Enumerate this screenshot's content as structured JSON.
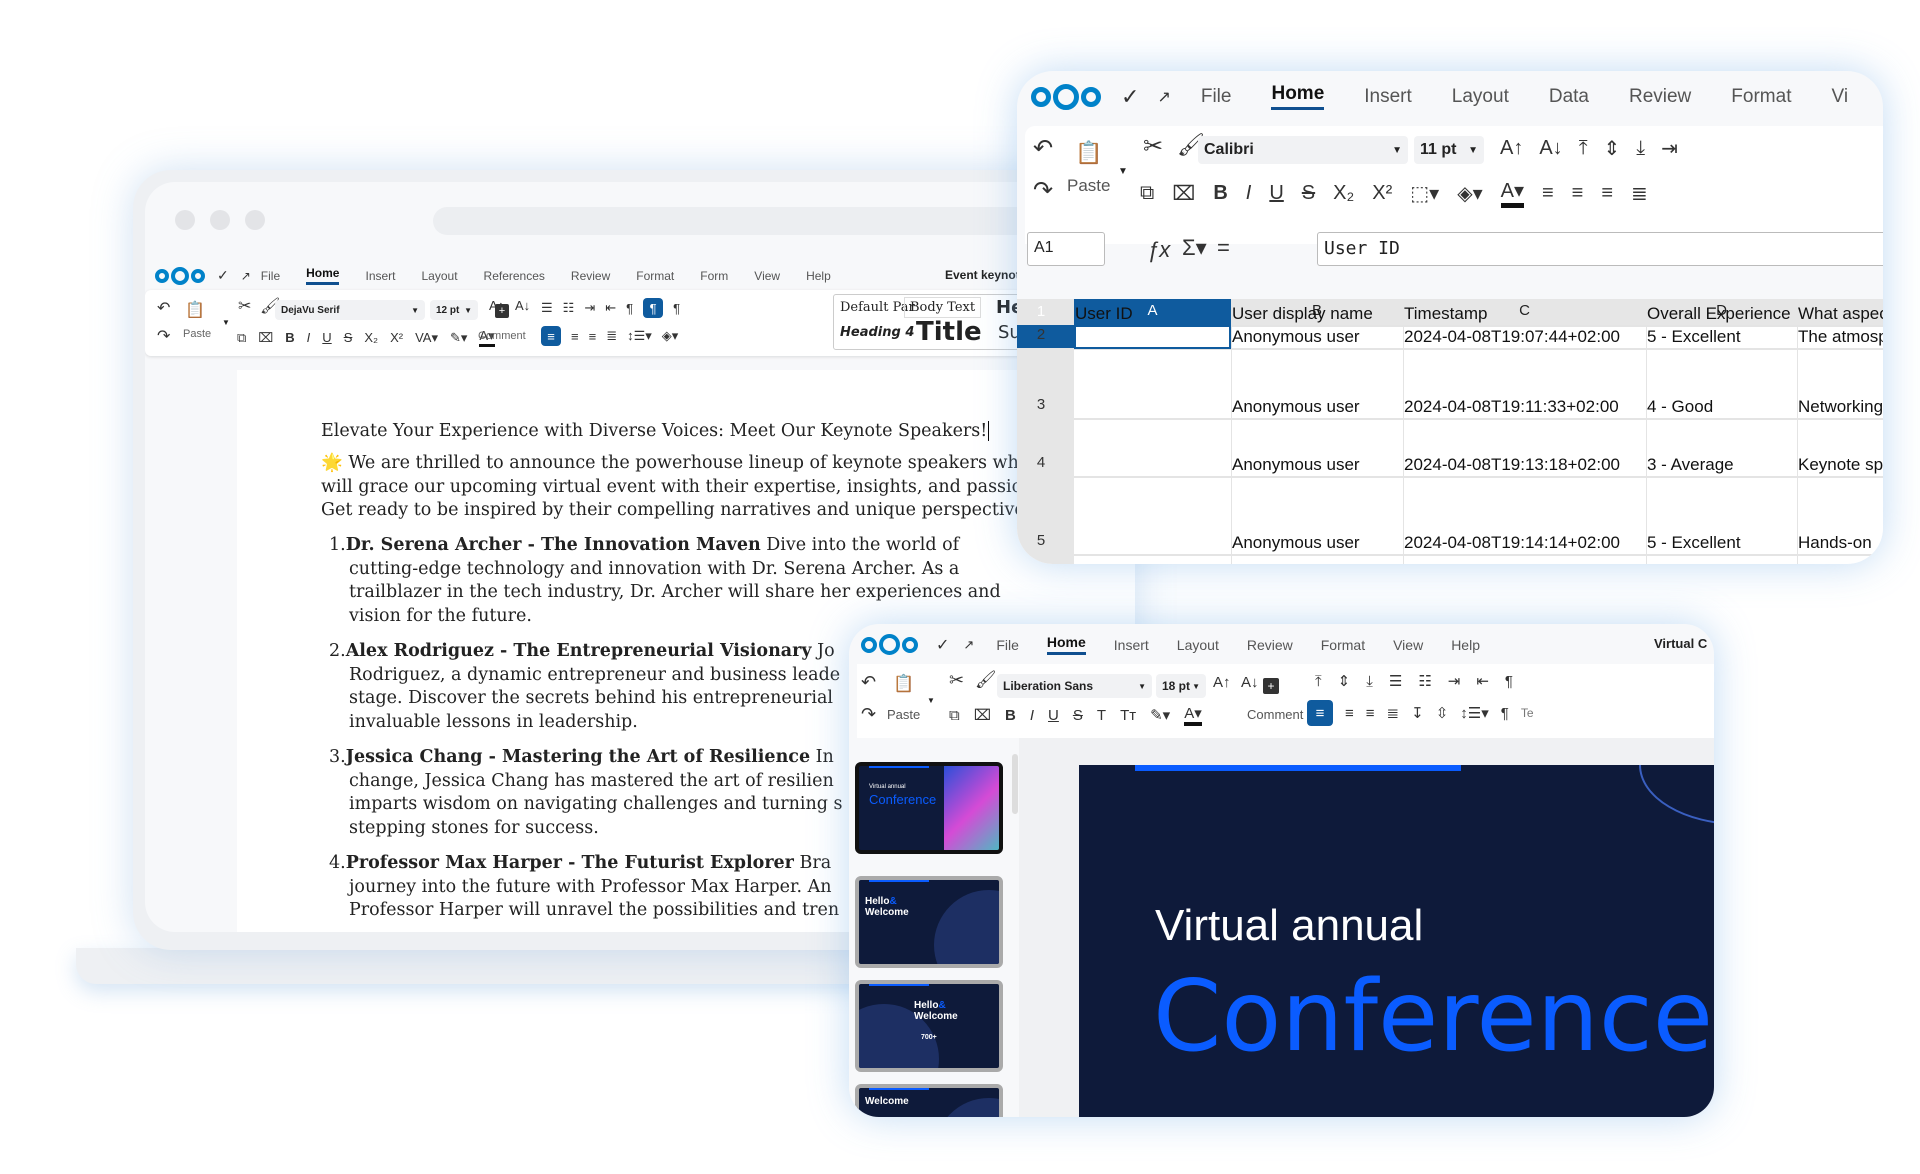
{
  "writer": {
    "doc_title": "Event keynot",
    "tabs": [
      "File",
      "Home",
      "Insert",
      "Layout",
      "References",
      "Review",
      "Format",
      "Form",
      "View",
      "Help"
    ],
    "active_tab": "Home",
    "font": "DejaVu Serif",
    "size": "12 pt",
    "paste_label": "Paste",
    "comment_label": "Comment",
    "styles": [
      "Default Par",
      "Body Text",
      "He",
      "Heading 4",
      "Title",
      "Su"
    ],
    "heading": "Elevate Your Experience with Diverse Voices: Meet Our Keynote Speakers!",
    "intro": [
      "🌟 We are thrilled to announce the powerhouse lineup of keynote speakers who",
      "will grace our upcoming virtual event with their expertise, insights, and passion",
      "Get ready to be inspired by their compelling narratives and unique perspectives"
    ],
    "items": [
      {
        "num": "1.",
        "title": "Dr. Serena Archer - The Innovation Maven",
        "first": " Dive into the world of",
        "lines": [
          "cutting-edge technology and innovation with Dr. Serena Archer. As a",
          "trailblazer in the tech industry, Dr. Archer will share her experiences and",
          "vision for the future."
        ]
      },
      {
        "num": "2.",
        "title": "Alex Rodriguez - The Entrepreneurial Visionary",
        "first": " Jo",
        "lines": [
          "Rodriguez, a dynamic entrepreneur and business leade",
          "stage. Discover the secrets behind his entrepreneurial",
          "invaluable lessons in leadership."
        ]
      },
      {
        "num": "3.",
        "title": "Jessica Chang - Mastering the Art of Resilience",
        "first": " In",
        "lines": [
          "change, Jessica Chang has mastered the art of resilien",
          "imparts wisdom on navigating challenges and turning s",
          "stepping stones for success."
        ]
      },
      {
        "num": "4.",
        "title": "Professor Max Harper - The Futurist Explorer",
        "first": " Bra",
        "lines": [
          "journey into the future with Professor Max Harper. An",
          "Professor Harper will unravel the possibilities and tren"
        ]
      }
    ]
  },
  "calc": {
    "tabs": [
      "File",
      "Home",
      "Insert",
      "Layout",
      "Data",
      "Review",
      "Format",
      "Vi"
    ],
    "active_tab": "Home",
    "font": "Calibri",
    "size": "11 pt",
    "paste_label": "Paste",
    "name_box": "A1",
    "formula": "User ID",
    "columns": [
      "A",
      "B",
      "C",
      "D"
    ],
    "rows": [
      "1",
      "2",
      "3",
      "4",
      "5"
    ],
    "cells": [
      [
        "User ID",
        "User display name",
        "Timestamp",
        "Overall Experience",
        "What aspec"
      ],
      [
        "",
        "Anonymous user",
        "2024-04-08T19:07:44+02:00",
        "5 - Excellent",
        "The atmosp"
      ],
      [
        "",
        "Anonymous user",
        "2024-04-08T19:11:33+02:00",
        "4 - Good",
        "Networking"
      ],
      [
        "",
        "Anonymous user",
        "2024-04-08T19:13:18+02:00",
        "3 - Average",
        "Keynote sp"
      ],
      [
        "",
        "Anonymous user",
        "2024-04-08T19:14:14+02:00",
        "5 - Excellent",
        "Hands-on"
      ]
    ]
  },
  "impress": {
    "doc_title": "Virtual C",
    "tabs": [
      "File",
      "Home",
      "Insert",
      "Layout",
      "Review",
      "Format",
      "View",
      "Help"
    ],
    "active_tab": "Home",
    "font": "Liberation Sans",
    "size": "18 pt",
    "paste_label": "Paste",
    "comment_label": "Comment",
    "text_label": "Te",
    "slide": {
      "line1": "Virtual annual",
      "line2": "Conference"
    },
    "thumbs": [
      {
        "a": "Virtual annual",
        "b": "Conference"
      },
      {
        "a": "Hello",
        "amp": "&",
        "b": "Welcome"
      },
      {
        "a": "Hello",
        "amp": "&",
        "b": "Welcome",
        "c": "700+"
      },
      {
        "b": "Welcome"
      }
    ]
  },
  "colors": {
    "brand": "#0082c9",
    "accent": "#0f5b9e",
    "slide_bg": "#0e1a3a",
    "slide_blue": "#0a5cff"
  }
}
